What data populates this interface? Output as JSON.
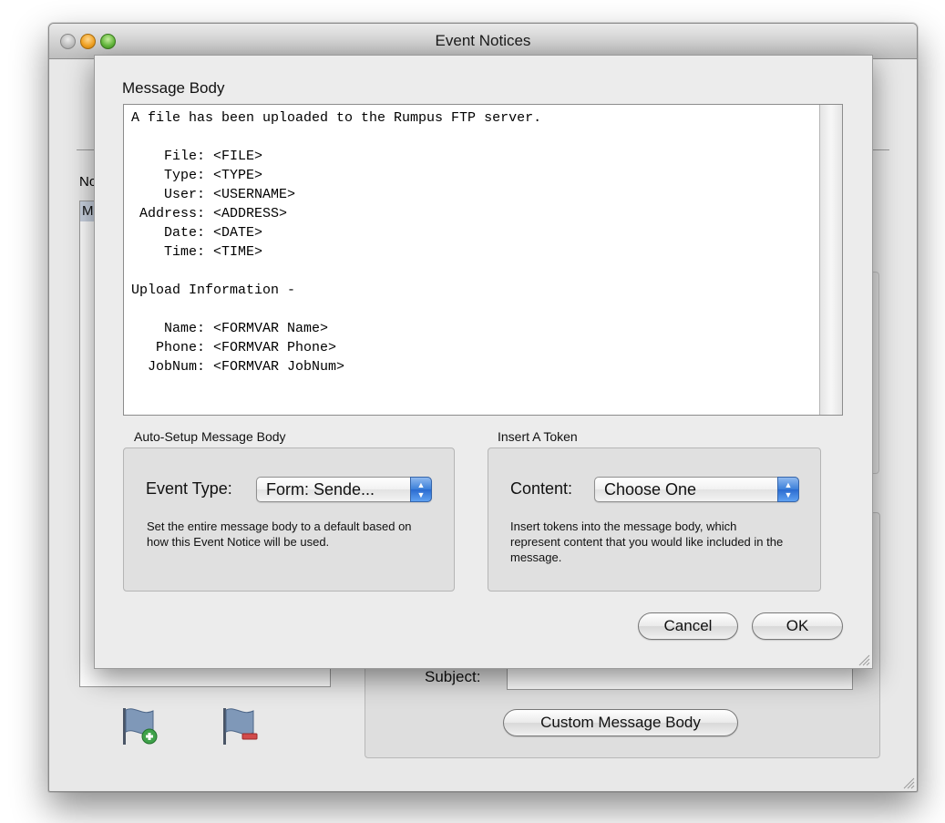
{
  "window": {
    "title": "Event Notices"
  },
  "left_panel": {
    "label": "No",
    "selected_item": "M"
  },
  "right_panel": {
    "subject_label": "Subject:",
    "subject_value": "",
    "custom_message_body_button": "Custom Message Body"
  },
  "sheet": {
    "title": "Message Body",
    "message_lines": [
      "A file has been uploaded to the Rumpus FTP server.",
      "",
      "    File: <FILE>",
      "    Type: <TYPE>",
      "    User: <USERNAME>",
      " Address: <ADDRESS>",
      "    Date: <DATE>",
      "    Time: <TIME>",
      "",
      "Upload Information -",
      "",
      "    Name: <FORMVAR Name>",
      "   Phone: <FORMVAR Phone>",
      "  JobNum: <FORMVAR JobNum>"
    ],
    "auto_setup": {
      "group_label": "Auto-Setup Message Body",
      "event_type_label": "Event Type:",
      "event_type_value": "Form: Sende...",
      "help": "Set the entire message body to a default based on how this Event Notice will be used."
    },
    "insert_token": {
      "group_label": "Insert A Token",
      "content_label": "Content:",
      "content_value": "Choose One",
      "help": "Insert tokens into the message body, which represent content that you would like included in the message."
    },
    "cancel_label": "Cancel",
    "ok_label": "OK"
  }
}
